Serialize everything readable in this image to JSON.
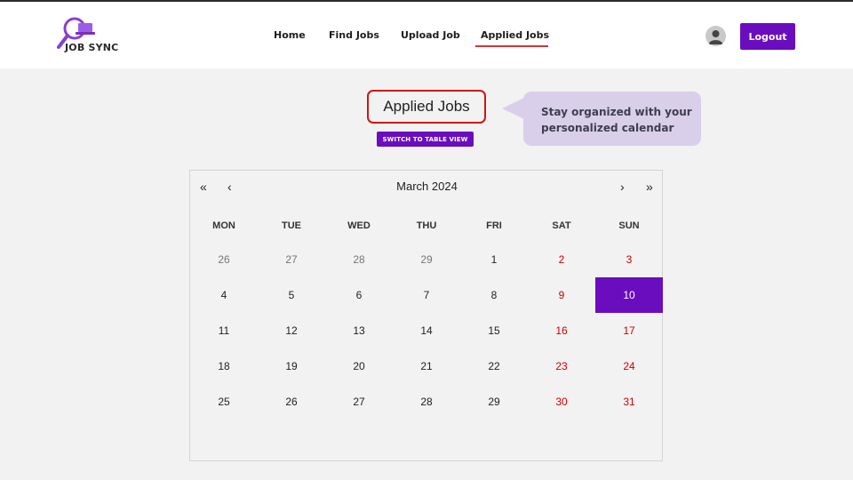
{
  "header": {
    "logo_text": "JOB SYNC",
    "nav": [
      {
        "label": "Home",
        "active": false
      },
      {
        "label": "Find Jobs",
        "active": false
      },
      {
        "label": "Upload Job",
        "active": false
      },
      {
        "label": "Applied Jobs",
        "active": true
      }
    ],
    "logout_label": "Logout"
  },
  "page": {
    "title": "Applied Jobs",
    "switch_button": "SWITCH TO TABLE VIEW",
    "tooltip": {
      "line1": "Stay organized with your",
      "line2": "personalized calendar"
    }
  },
  "calendar": {
    "month_label": "March 2024",
    "nav": {
      "prev_year": "«",
      "prev_month": "‹",
      "next_month": "›",
      "next_year": "»"
    },
    "weekdays": [
      "MON",
      "TUE",
      "WED",
      "THU",
      "FRI",
      "SAT",
      "SUN"
    ],
    "weeks": [
      [
        "26",
        "27",
        "28",
        "29",
        "1",
        "2",
        "3"
      ],
      [
        "4",
        "5",
        "6",
        "7",
        "8",
        "9",
        "10"
      ],
      [
        "11",
        "12",
        "13",
        "14",
        "15",
        "16",
        "17"
      ],
      [
        "18",
        "19",
        "20",
        "21",
        "22",
        "23",
        "24"
      ],
      [
        "25",
        "26",
        "27",
        "28",
        "29",
        "30",
        "31"
      ]
    ],
    "outside_month_days": [
      "26",
      "27",
      "28",
      "29"
    ],
    "selected_day": "10",
    "colors": {
      "accent": "#6a0dbe",
      "weekend": "#d10000",
      "highlight_border": "#d21414",
      "tooltip_bg": "#d9cfea"
    }
  }
}
